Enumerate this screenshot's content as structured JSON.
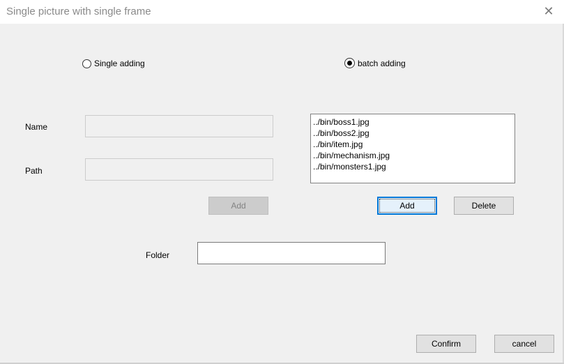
{
  "window": {
    "title": "Single picture with single frame",
    "close_icon": "close-icon"
  },
  "mode": {
    "single_label": "Single adding",
    "batch_label": "batch adding",
    "selected": "batch adding"
  },
  "single": {
    "name_label": "Name",
    "name_value": "",
    "path_label": "Path",
    "path_value": "",
    "add_label": "Add"
  },
  "batch": {
    "files": [
      "../bin/boss1.jpg",
      "../bin/boss2.jpg",
      "../bin/item.jpg",
      "../bin/mechanism.jpg",
      "../bin/monsters1.jpg"
    ],
    "add_label": "Add",
    "delete_label": "Delete"
  },
  "folder": {
    "label": "Folder",
    "value": ""
  },
  "footer": {
    "confirm_label": "Confirm",
    "cancel_label": "cancel"
  }
}
